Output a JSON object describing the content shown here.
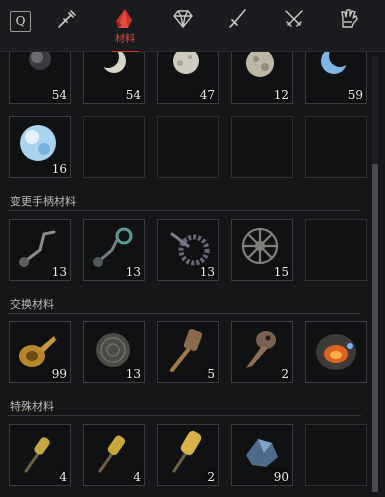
{
  "hotkey": {
    "label": "Q"
  },
  "tabs": [
    {
      "icon": "syringe-icon",
      "label": "",
      "active": false
    },
    {
      "icon": "red-crystal-icon",
      "label": "材料",
      "active": true
    },
    {
      "icon": "diamond-gem-icon",
      "label": "",
      "active": false
    },
    {
      "icon": "dagger-icon",
      "label": "",
      "active": false
    },
    {
      "icon": "crossed-swords-icon",
      "label": "",
      "active": false
    },
    {
      "icon": "gauntlet-icon",
      "label": "",
      "active": false
    }
  ],
  "sections": [
    {
      "title": "",
      "items": [
        {
          "icon": "dark-moon-orb-icon",
          "count": "54"
        },
        {
          "icon": "crescent-moon-icon",
          "count": "54"
        },
        {
          "icon": "gibbous-moon-icon",
          "count": "47"
        },
        {
          "icon": "full-moon-icon",
          "count": "12"
        },
        {
          "icon": "blue-crescent-moon-icon",
          "count": "59"
        },
        {
          "icon": "opal-sphere-icon",
          "count": "16"
        },
        {
          "icon": "",
          "count": ""
        },
        {
          "icon": "",
          "count": ""
        },
        {
          "icon": "",
          "count": ""
        },
        {
          "icon": "",
          "count": ""
        }
      ]
    },
    {
      "title": "变更手柄材料",
      "items": [
        {
          "icon": "crank-handle-icon",
          "count": "13"
        },
        {
          "icon": "gear-crank-icon",
          "count": "13"
        },
        {
          "icon": "cog-handle-icon",
          "count": "13"
        },
        {
          "icon": "spoked-wheel-icon",
          "count": "15"
        },
        {
          "icon": "",
          "count": ""
        }
      ]
    },
    {
      "title": "交换材料",
      "items": [
        {
          "icon": "brass-horn-icon",
          "count": "99"
        },
        {
          "icon": "engraved-disc-icon",
          "count": "13"
        },
        {
          "icon": "pipe-bellows-icon",
          "count": "5"
        },
        {
          "icon": "plague-mask-icon",
          "count": "2"
        },
        {
          "icon": "glowing-mechanism-icon",
          "count": ""
        }
      ]
    },
    {
      "title": "特殊材料",
      "items": [
        {
          "icon": "small-flask-icon",
          "count": "4"
        },
        {
          "icon": "small-vial-icon",
          "count": "4"
        },
        {
          "icon": "large-vial-icon",
          "count": "2"
        },
        {
          "icon": "blue-relic-fragment-icon",
          "count": "90"
        },
        {
          "icon": "",
          "count": ""
        }
      ]
    }
  ],
  "colors": {
    "accent": "#d93a30",
    "background": "#151618",
    "slot_border": "#3a3b40"
  }
}
